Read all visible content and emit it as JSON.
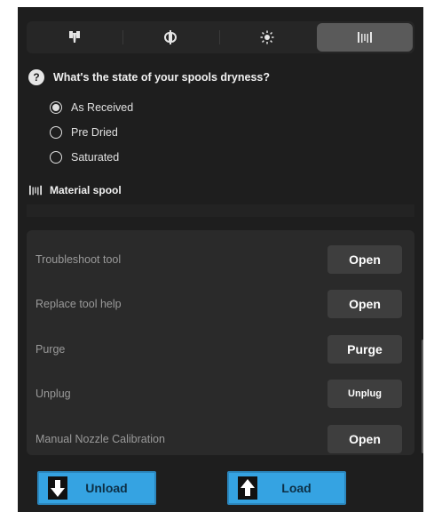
{
  "tabs": [
    {
      "icon": "tool-head-icon",
      "active": false
    },
    {
      "icon": "nozzle-icon",
      "active": false
    },
    {
      "icon": "heater-sun-icon",
      "active": false
    },
    {
      "icon": "spool-icon",
      "active": true
    }
  ],
  "dryness": {
    "question": "What's the state of your spools dryness?",
    "options": [
      {
        "label": "As Received",
        "selected": true
      },
      {
        "label": "Pre Dried",
        "selected": false
      },
      {
        "label": "Saturated",
        "selected": false
      }
    ]
  },
  "material_spool": {
    "title": "Material spool"
  },
  "tools": [
    {
      "label": "Troubleshoot tool",
      "button": "Open"
    },
    {
      "label": "Replace tool help",
      "button": "Open"
    },
    {
      "label": "Purge",
      "button": "Purge"
    },
    {
      "label": "Unplug",
      "button": "Unplug"
    },
    {
      "label": "Manual Nozzle Calibration",
      "button": "Open"
    }
  ],
  "actions": {
    "unload": "Unload",
    "load": "Load"
  },
  "colors": {
    "panel_bg": "#1e1e1e",
    "accent_blue": "#35a3e2"
  }
}
